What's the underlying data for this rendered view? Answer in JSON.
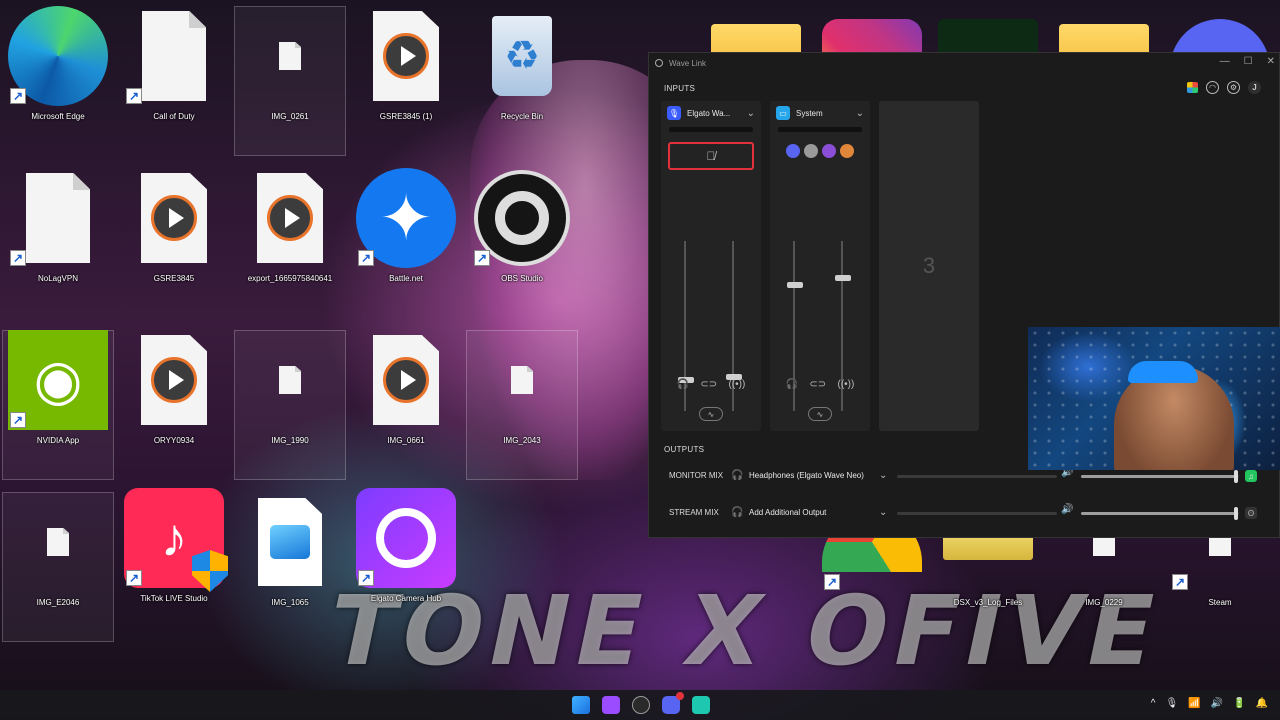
{
  "desktop": {
    "wallpaper_text": "TONE X OFIVE",
    "icons": [
      {
        "label": "Microsoft Edge",
        "kind": "edge",
        "shortcut": true
      },
      {
        "label": "Call of Duty",
        "kind": "doc",
        "shortcut": true
      },
      {
        "label": "IMG_0261",
        "kind": "doc-small",
        "shortcut": false
      },
      {
        "label": "GSRE3845 (1)",
        "kind": "play",
        "shortcut": false
      },
      {
        "label": "Recycle Bin",
        "kind": "recycle",
        "shortcut": false
      },
      {
        "label": "NoLagVPN",
        "kind": "doc",
        "shortcut": true
      },
      {
        "label": "GSRE3845",
        "kind": "play",
        "shortcut": false
      },
      {
        "label": "export_1665975840641",
        "kind": "play",
        "shortcut": false
      },
      {
        "label": "Battle.net",
        "kind": "battle",
        "shortcut": true
      },
      {
        "label": "OBS Studio",
        "kind": "obs",
        "shortcut": true
      },
      {
        "label": "NVIDIA App",
        "kind": "nvidia",
        "shortcut": true
      },
      {
        "label": "ORYY0934",
        "kind": "play",
        "shortcut": false
      },
      {
        "label": "IMG_1990",
        "kind": "doc-small",
        "shortcut": false
      },
      {
        "label": "IMG_0661",
        "kind": "play",
        "shortcut": false
      },
      {
        "label": "IMG_2043",
        "kind": "doc-small",
        "shortcut": false
      },
      {
        "label": "IMG_E2046",
        "kind": "doc-small",
        "shortcut": false
      },
      {
        "label": "TikTok LIVE Studio",
        "kind": "tiktok",
        "shortcut": true
      },
      {
        "label": "IMG_1065",
        "kind": "photos",
        "shortcut": false
      },
      {
        "label": "Elgato Camera Hub",
        "kind": "camhub",
        "shortcut": true
      },
      {
        "label": "DSX_v3_Log_Files",
        "kind": "zip",
        "shortcut": false
      },
      {
        "label": "IMG_0229",
        "kind": "doc-small",
        "shortcut": false
      },
      {
        "label": "Steam",
        "kind": "doc-small",
        "shortcut": true
      }
    ]
  },
  "wavelink": {
    "title": "Wave Link",
    "window_controls": {
      "minimize": "—",
      "maximize": "☐",
      "close": "✕"
    },
    "avatar_initial": "J",
    "inputs_label": "INPUTS",
    "outputs_label": "OUTPUTS",
    "channels": [
      {
        "name": "Elgato Wa...",
        "badge_color": "#3b5cff",
        "badge_glyph": "🎙",
        "muted": true,
        "mute_glyph": "🎙̸",
        "monitor_level": 0.18,
        "stream_level": 0.2
      },
      {
        "name": "System",
        "badge_color": "#26a6ea",
        "badge_glyph": "▭",
        "muted": false,
        "apps": [
          "#5865f2",
          "#9a9a9a",
          "#8a4fd6",
          "#e0873b"
        ],
        "monitor_level": 0.74,
        "stream_level": 0.78
      }
    ],
    "empty_slot_glyph": "3",
    "outputs": [
      {
        "label": "MONITOR MIX",
        "device": "Headphones (Elgato Wave Neo)",
        "level": 0.98,
        "end_color": "#22c55e"
      },
      {
        "label": "STREAM MIX",
        "device": "Add Additional Output",
        "level": 0.98,
        "end_color": "#333333"
      }
    ]
  },
  "taskbar": {
    "apps": [
      "windows-start",
      "elgato-camera-hub",
      "wave-link",
      "discord",
      "stream-deck"
    ],
    "tray": [
      "^",
      "🎙",
      "📶",
      "🔊",
      "🔋",
      "🔔"
    ]
  },
  "colors": {
    "accent_red": "#e4323c",
    "panel_bg": "#1b1b1b",
    "channel_bg": "#232323"
  }
}
